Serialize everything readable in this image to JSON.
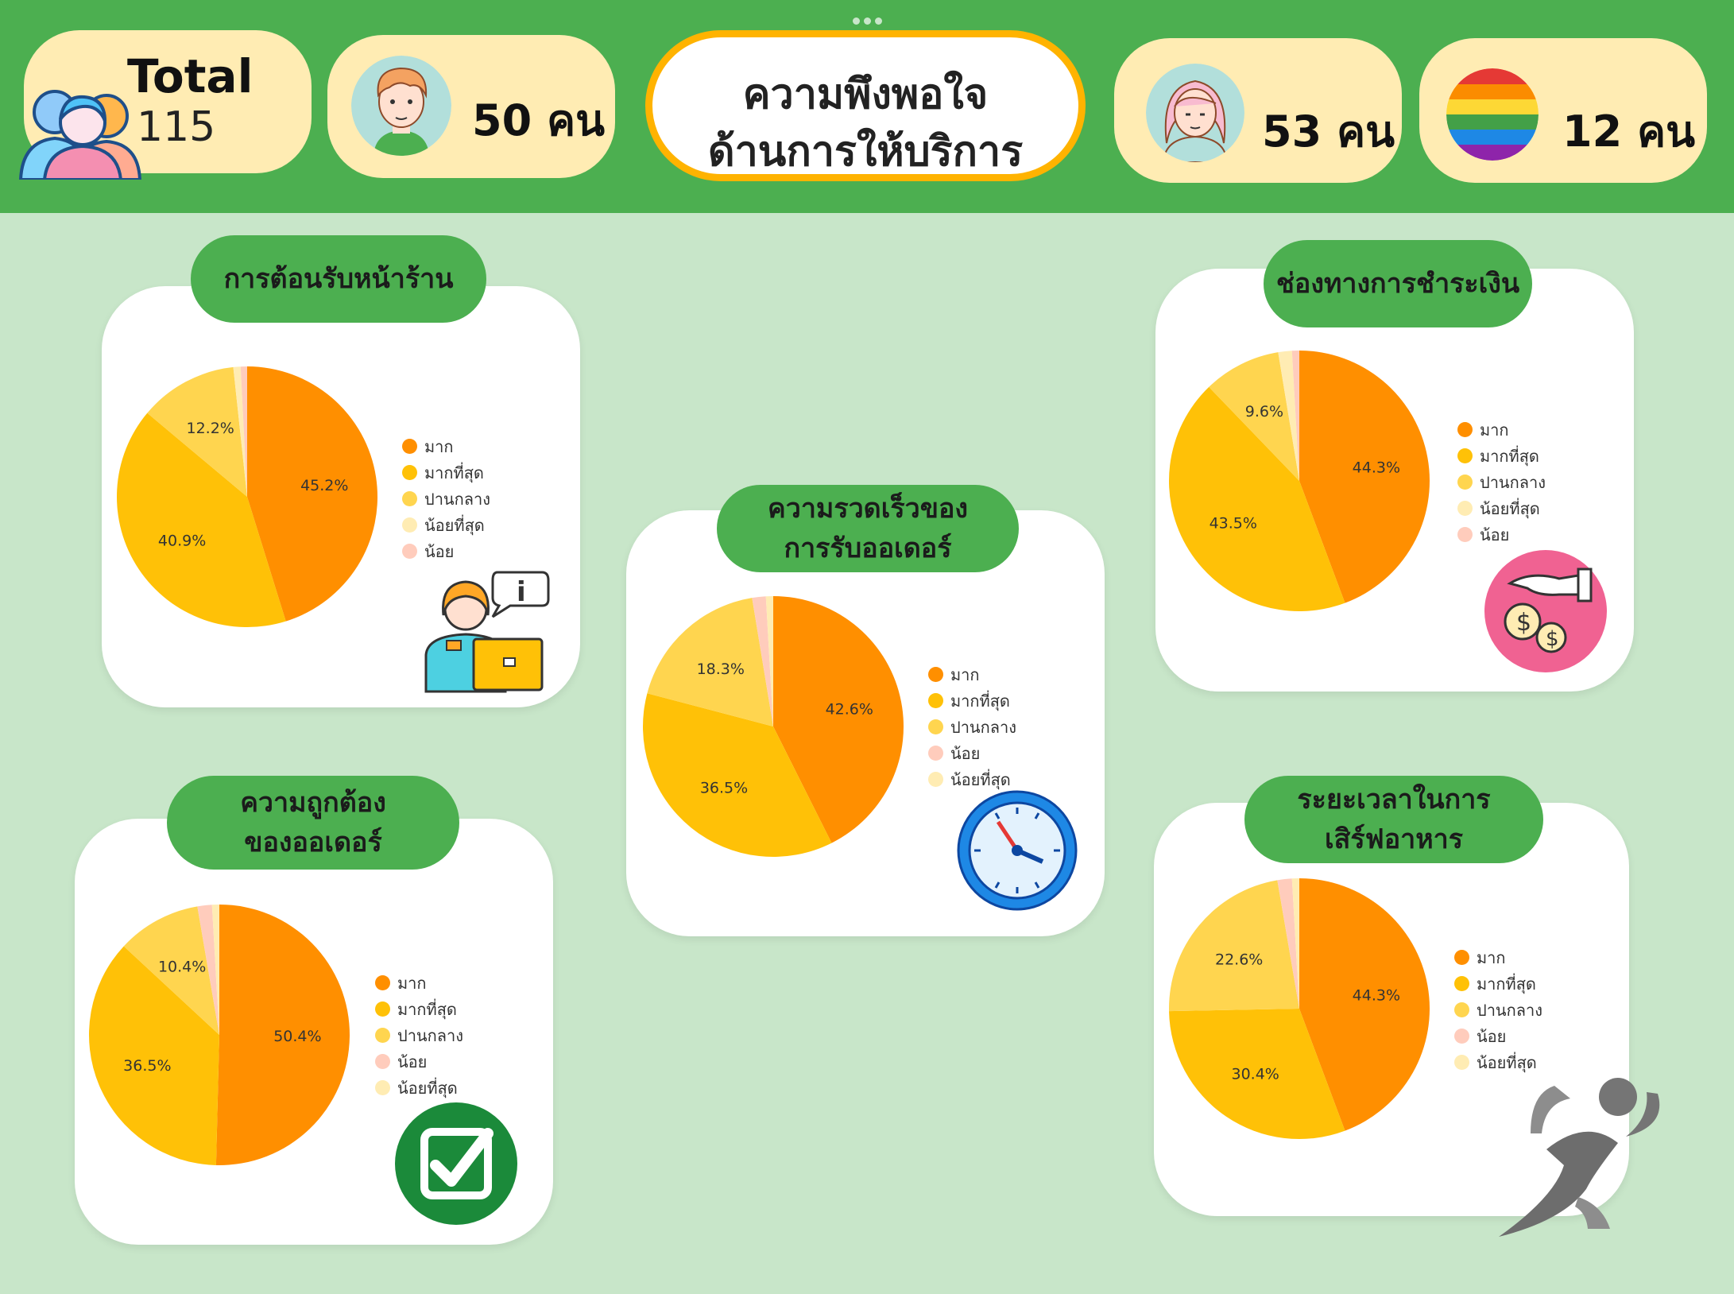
{
  "header": {
    "total_label": "Total",
    "total_value": "115",
    "male_count": "50 คน",
    "title_line1": "ความพึงพอใจ",
    "title_line2": "ด้านการให้บริการ",
    "female_count": "53 คน",
    "lgbt_count": "12 คน"
  },
  "icons": {
    "people": "group-people-icon",
    "male": "male-avatar-icon",
    "female": "female-avatar-icon",
    "lgbt": "rainbow-flag-icon",
    "reception": "customer-service-icon",
    "speed": "clock-icon",
    "payment": "money-hand-icon",
    "accuracy": "checkmark-icon",
    "serve_time": "runner-icon"
  },
  "colors": {
    "header_green": "#4caf50",
    "background": "#c8e6c9",
    "mak": "#ff8f00",
    "mak_tisut": "#ffc107",
    "panklang": "#ffd54f",
    "noi_tisut": "#ffecb3",
    "noi": "#ffccbc"
  },
  "chart_data": [
    {
      "type": "pie",
      "title": "การต้อนรับหน้าร้าน",
      "categories": [
        "มาก",
        "มากที่สุด",
        "ปานกลาง",
        "น้อยที่สุด",
        "น้อย"
      ],
      "values": [
        45.2,
        40.9,
        12.2,
        0.9,
        0.8
      ],
      "labels": [
        "45.2%",
        "40.9%",
        "12.2%",
        "",
        ""
      ],
      "colors": [
        "#ff8f00",
        "#ffc107",
        "#ffd54f",
        "#ffecb3",
        "#ffccbc"
      ],
      "legend": "right"
    },
    {
      "type": "pie",
      "title": "ความรวดเร็วของการรับออเดอร์",
      "title_lines": [
        "ความรวดเร็วของ",
        "การรับออเดอร์"
      ],
      "categories": [
        "มาก",
        "มากที่สุด",
        "ปานกลาง",
        "น้อย",
        "น้อยที่สุด"
      ],
      "values": [
        42.6,
        36.5,
        18.3,
        1.7,
        0.9
      ],
      "labels": [
        "42.6%",
        "36.5%",
        "18.3%",
        "",
        ""
      ],
      "colors": [
        "#ff8f00",
        "#ffc107",
        "#ffd54f",
        "#ffccbc",
        "#ffecb3"
      ],
      "legend": "right"
    },
    {
      "type": "pie",
      "title": "ช่องทางการชำระเงิน",
      "categories": [
        "มาก",
        "มากที่สุด",
        "ปานกลาง",
        "น้อยที่สุด",
        "น้อย"
      ],
      "values": [
        44.3,
        43.5,
        9.6,
        1.7,
        0.9
      ],
      "labels": [
        "44.3%",
        "43.5%",
        "9.6%",
        "",
        ""
      ],
      "colors": [
        "#ff8f00",
        "#ffc107",
        "#ffd54f",
        "#ffecb3",
        "#ffccbc"
      ],
      "legend": "right"
    },
    {
      "type": "pie",
      "title": "ความถูกต้องของออเดอร์",
      "title_lines": [
        "ความถูกต้อง",
        "ของออเดอร์"
      ],
      "categories": [
        "มาก",
        "มากที่สุด",
        "ปานกลาง",
        "น้อย",
        "น้อยที่สุด"
      ],
      "values": [
        50.4,
        36.5,
        10.4,
        1.8,
        0.9
      ],
      "labels": [
        "50.4%",
        "36.5%",
        "10.4%",
        "",
        ""
      ],
      "colors": [
        "#ff8f00",
        "#ffc107",
        "#ffd54f",
        "#ffccbc",
        "#ffecb3"
      ],
      "legend": "right"
    },
    {
      "type": "pie",
      "title": "ระยะเวลาในการเสิร์ฟอาหาร",
      "title_lines": [
        "ระยะเวลาในการ",
        "เสิร์ฟอาหาร"
      ],
      "categories": [
        "มาก",
        "มากที่สุด",
        "ปานกลาง",
        "น้อย",
        "น้อยที่สุด"
      ],
      "values": [
        44.3,
        30.4,
        22.6,
        1.8,
        0.9
      ],
      "labels": [
        "44.3%",
        "30.4%",
        "22.6%",
        "",
        ""
      ],
      "colors": [
        "#ff8f00",
        "#ffc107",
        "#ffd54f",
        "#ffccbc",
        "#ffecb3"
      ],
      "legend": "right"
    }
  ]
}
